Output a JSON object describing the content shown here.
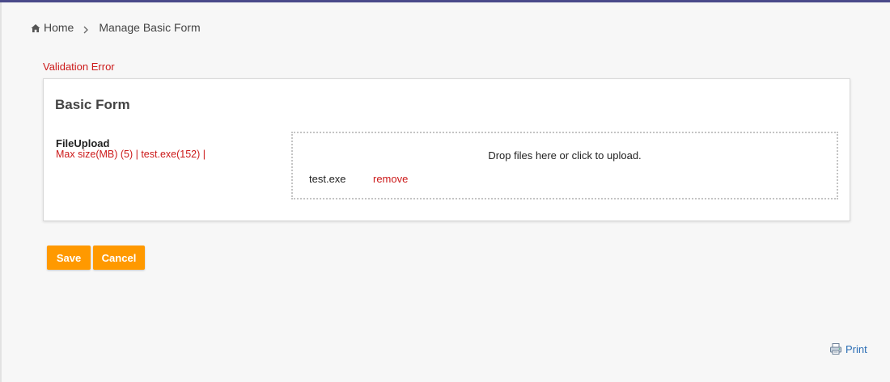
{
  "breadcrumb": {
    "home_icon": "home-icon",
    "home_label": "Home",
    "separator_icon": "chevron-right-icon",
    "current": "Manage Basic Form"
  },
  "validation": {
    "message": "Validation Error",
    "color": "#cc1a1a"
  },
  "form": {
    "title": "Basic Form",
    "field": {
      "label": "FileUpload",
      "error": "Max size(MB) (5) | test.exe(152) |"
    },
    "dropzone": {
      "message": "Drop files here or click to upload.",
      "files": [
        {
          "name": "test.exe",
          "remove_label": "remove"
        }
      ]
    }
  },
  "actions": {
    "save_label": "Save",
    "cancel_label": "Cancel",
    "button_color": "#ff9900"
  },
  "footer": {
    "print_icon": "print-icon",
    "print_label": "Print",
    "link_color": "#2a6db5"
  }
}
